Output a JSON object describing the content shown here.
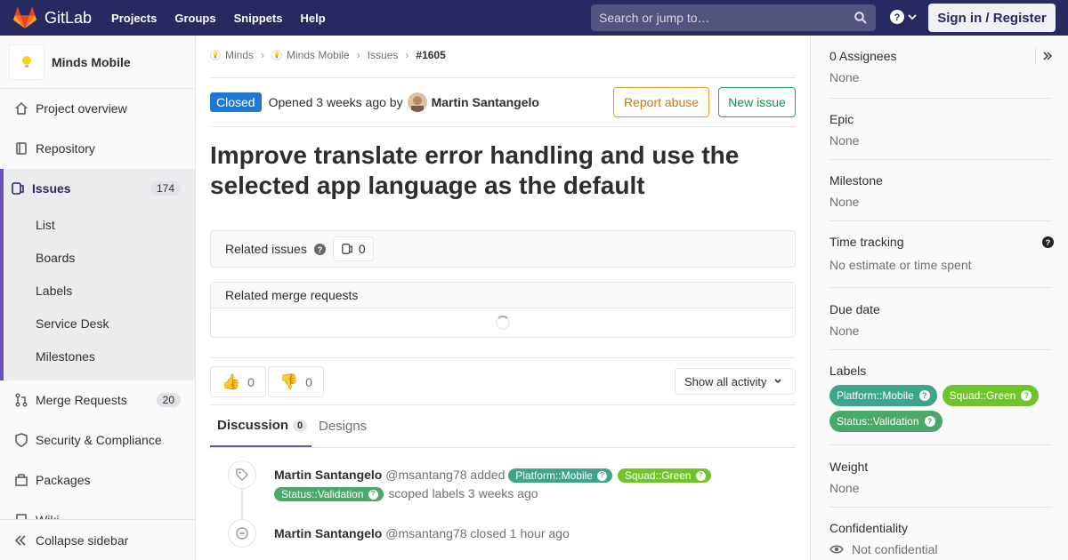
{
  "topbar": {
    "brand": "GitLab",
    "nav": [
      "Projects",
      "Groups",
      "Snippets",
      "Help"
    ],
    "search_placeholder": "Search or jump to…",
    "signin": "Sign in / Register"
  },
  "sidebar": {
    "project_name": "Minds Mobile",
    "items": {
      "overview": "Project overview",
      "repository": "Repository",
      "issues": "Issues",
      "issues_count": "174",
      "list": "List",
      "boards": "Boards",
      "labels": "Labels",
      "service_desk": "Service Desk",
      "milestones": "Milestones",
      "merge_requests": "Merge Requests",
      "mr_count": "20",
      "security": "Security & Compliance",
      "packages": "Packages",
      "wiki": "Wiki"
    },
    "collapse": "Collapse sidebar"
  },
  "breadcrumb": [
    "Minds",
    "Minds Mobile",
    "Issues",
    "#1605"
  ],
  "issue": {
    "status": "Closed",
    "opened": "Opened 3 weeks ago by",
    "author": "Martin Santangelo",
    "report_abuse": "Report abuse",
    "new_issue": "New issue",
    "title": "Improve translate error handling and use the selected app language as the default",
    "related_issues": "Related issues",
    "related_issues_count": "0",
    "related_mrs": "Related merge requests",
    "thumbs_up": "0",
    "thumbs_down": "0",
    "show_activity": "Show all activity",
    "tab_discussion": "Discussion",
    "discussion_count": "0",
    "tab_designs": "Designs"
  },
  "notes": [
    {
      "author": "Martin Santangelo",
      "handle": "@msantang78",
      "action": "added",
      "labels": [
        "Platform::Mobile",
        "Squad::Green",
        "Status::Validation"
      ],
      "suffix": "scoped labels 3 weeks ago"
    },
    {
      "author": "Martin Santangelo",
      "handle": "@msantang78",
      "action": "closed 1 hour ago"
    }
  ],
  "right_sidebar": {
    "assignees_title": "0 Assignees",
    "assignees_value": "None",
    "epic_title": "Epic",
    "epic_value": "None",
    "milestone_title": "Milestone",
    "milestone_value": "None",
    "time_title": "Time tracking",
    "time_value": "No estimate or time spent",
    "due_title": "Due date",
    "due_value": "None",
    "labels_title": "Labels",
    "labels": [
      "Platform::Mobile",
      "Squad::Green",
      "Status::Validation"
    ],
    "weight_title": "Weight",
    "weight_value": "None",
    "conf_title": "Confidentiality",
    "conf_value": "Not confidential"
  },
  "colors": {
    "nav": "#292961",
    "accent": "#6b4fbb",
    "closed": "#1f78d1",
    "label_platform": "#3ea58a",
    "label_squad": "#6ec52a",
    "label_status": "#4ba86a"
  }
}
